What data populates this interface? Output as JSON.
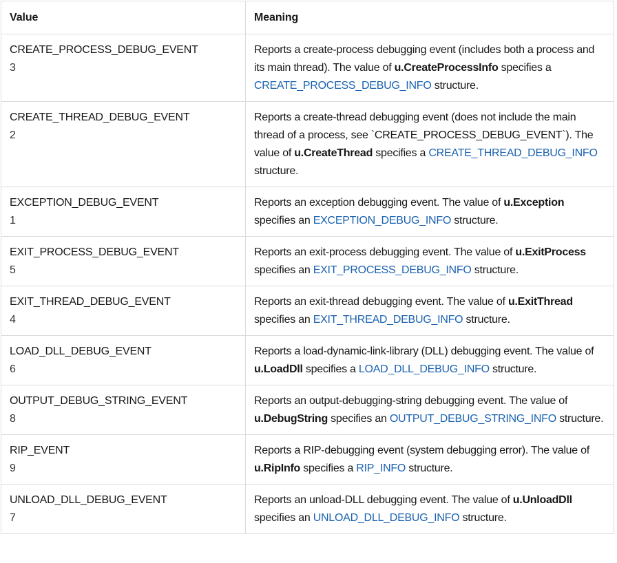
{
  "table": {
    "headers": {
      "value": "Value",
      "meaning": "Meaning"
    },
    "rows": [
      {
        "name": "CREATE_PROCESS_DEBUG_EVENT",
        "code": "3",
        "meaning": [
          {
            "t": "text",
            "v": "Reports a create-process debugging event (includes both a process and its main thread). The value of "
          },
          {
            "t": "bold",
            "v": "u.CreateProcessInfo"
          },
          {
            "t": "text",
            "v": " specifies a "
          },
          {
            "t": "link",
            "v": "CREATE_PROCESS_DEBUG_INFO"
          },
          {
            "t": "text",
            "v": " structure."
          }
        ]
      },
      {
        "name": "CREATE_THREAD_DEBUG_EVENT",
        "code": "2",
        "meaning": [
          {
            "t": "text",
            "v": "Reports a create-thread debugging event (does not include the main thread of a process, see `CREATE_PROCESS_DEBUG_EVENT`). The value of "
          },
          {
            "t": "bold",
            "v": "u.CreateThread"
          },
          {
            "t": "text",
            "v": " specifies a "
          },
          {
            "t": "link",
            "v": "CREATE_THREAD_DEBUG_INFO"
          },
          {
            "t": "text",
            "v": " structure."
          }
        ]
      },
      {
        "name": "EXCEPTION_DEBUG_EVENT",
        "code": "1",
        "meaning": [
          {
            "t": "text",
            "v": "Reports an exception debugging event. The value of "
          },
          {
            "t": "bold",
            "v": "u.Exception"
          },
          {
            "t": "text",
            "v": " specifies an "
          },
          {
            "t": "link",
            "v": "EXCEPTION_DEBUG_INFO"
          },
          {
            "t": "text",
            "v": " structure."
          }
        ]
      },
      {
        "name": "EXIT_PROCESS_DEBUG_EVENT",
        "code": "5",
        "meaning": [
          {
            "t": "text",
            "v": "Reports an exit-process debugging event. The value of "
          },
          {
            "t": "bold",
            "v": "u.ExitProcess"
          },
          {
            "t": "text",
            "v": " specifies an "
          },
          {
            "t": "link",
            "v": "EXIT_PROCESS_DEBUG_INFO"
          },
          {
            "t": "text",
            "v": " structure."
          }
        ]
      },
      {
        "name": "EXIT_THREAD_DEBUG_EVENT",
        "code": "4",
        "meaning": [
          {
            "t": "text",
            "v": "Reports an exit-thread debugging event. The value of "
          },
          {
            "t": "bold",
            "v": "u.ExitThread"
          },
          {
            "t": "text",
            "v": " specifies an "
          },
          {
            "t": "link",
            "v": "EXIT_THREAD_DEBUG_INFO"
          },
          {
            "t": "text",
            "v": " structure."
          }
        ]
      },
      {
        "name": "LOAD_DLL_DEBUG_EVENT",
        "code": "6",
        "meaning": [
          {
            "t": "text",
            "v": "Reports a load-dynamic-link-library (DLL) debugging event. The value of "
          },
          {
            "t": "bold",
            "v": "u.LoadDll"
          },
          {
            "t": "text",
            "v": " specifies a "
          },
          {
            "t": "link",
            "v": "LOAD_DLL_DEBUG_INFO"
          },
          {
            "t": "text",
            "v": " structure."
          }
        ]
      },
      {
        "name": "OUTPUT_DEBUG_STRING_EVENT",
        "code": "8",
        "meaning": [
          {
            "t": "text",
            "v": "Reports an output-debugging-string debugging event. The value of "
          },
          {
            "t": "bold",
            "v": "u.DebugString"
          },
          {
            "t": "text",
            "v": " specifies an "
          },
          {
            "t": "link",
            "v": "OUTPUT_DEBUG_STRING_INFO"
          },
          {
            "t": "text",
            "v": " structure."
          }
        ]
      },
      {
        "name": "RIP_EVENT",
        "code": "9",
        "meaning": [
          {
            "t": "text",
            "v": "Reports a RIP-debugging event (system debugging error). The value of "
          },
          {
            "t": "bold",
            "v": "u.RipInfo"
          },
          {
            "t": "text",
            "v": " specifies a "
          },
          {
            "t": "link",
            "v": "RIP_INFO"
          },
          {
            "t": "text",
            "v": " structure."
          }
        ]
      },
      {
        "name": "UNLOAD_DLL_DEBUG_EVENT",
        "code": "7",
        "meaning": [
          {
            "t": "text",
            "v": "Reports an unload-DLL debugging event. The value of "
          },
          {
            "t": "bold",
            "v": "u.UnloadDll"
          },
          {
            "t": "text",
            "v": " specifies an "
          },
          {
            "t": "link",
            "v": "UNLOAD_DLL_DEBUG_INFO"
          },
          {
            "t": "text",
            "v": " structure."
          }
        ]
      }
    ]
  }
}
